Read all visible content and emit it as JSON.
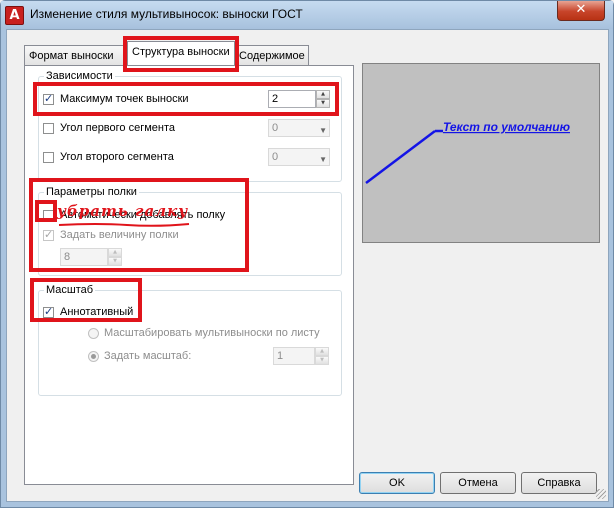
{
  "window": {
    "title": "Изменение стиля мультивыносок: выноски ГОСТ",
    "app_icon_letter": "A",
    "close_glyph": "✕"
  },
  "tabs": [
    {
      "label": "Формат выноски"
    },
    {
      "label": "Структура выноски",
      "active": true
    },
    {
      "label": "Содержимое"
    }
  ],
  "constraints": {
    "title": "Зависимости",
    "max_points": {
      "label": "Максимум точек выноски",
      "checked": true,
      "value": "2"
    },
    "first_segment": {
      "label": "Угол первого сегмента",
      "checked": false,
      "value": "0"
    },
    "second_segment": {
      "label": "Угол второго сегмента",
      "checked": false,
      "value": "0"
    }
  },
  "landing": {
    "title": "Параметры полки",
    "auto_landing": {
      "label": "Автоматически добавлять полку",
      "checked": false
    },
    "landing_distance": {
      "label": "Задать величину полки",
      "checked": true,
      "value": "8"
    }
  },
  "scale": {
    "title": "Масштаб",
    "annotative": {
      "label": "Аннотативный",
      "checked": true
    },
    "scale_to_layout": {
      "label": "Масштабировать мультивыноски по листу"
    },
    "specify_scale": {
      "label": "Задать масштаб:",
      "value": "1"
    }
  },
  "annotation": {
    "text": "убрать галку"
  },
  "preview": {
    "text": "Текст по умолчанию",
    "leader_color": "#1414e6"
  },
  "buttons": {
    "ok": "OK",
    "cancel": "Отмена",
    "help": "Справка"
  },
  "colors": {
    "highlight": "#e0141b"
  }
}
